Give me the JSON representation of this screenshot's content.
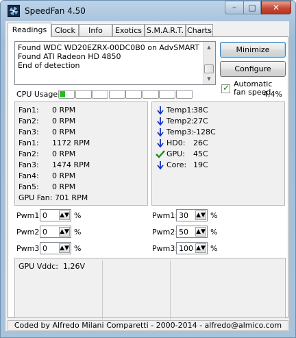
{
  "window": {
    "title": "SpeedFan 4.50",
    "minimize_glyph": "–",
    "maximize_glyph": "□",
    "close_glyph": "✕",
    "app_icon": "fan-icon"
  },
  "tabs": [
    "Readings",
    "Clock",
    "Info",
    "Exotics",
    "S.M.A.R.T.",
    "Charts"
  ],
  "log_lines": [
    "Found WDC WD20EZRX-00DC0B0 on AdvSMART",
    "Found ATI Radeon HD 4850",
    "End of detection"
  ],
  "buttons": {
    "minimize": "Minimize",
    "configure": "Configure"
  },
  "auto_fan": {
    "label": "Automatic fan speed",
    "checked": true
  },
  "cpu_usage": {
    "label": "CPU Usage",
    "value": "4,4%",
    "fraction": 0.044
  },
  "fans": [
    {
      "label": "Fan1:",
      "value": "0 RPM"
    },
    {
      "label": "Fan2:",
      "value": "0 RPM"
    },
    {
      "label": "Fan3:",
      "value": "0 RPM"
    },
    {
      "label": "Fan1:",
      "value": "1172 RPM"
    },
    {
      "label": "Fan2:",
      "value": "0 RPM"
    },
    {
      "label": "Fan3:",
      "value": "1474 RPM"
    },
    {
      "label": "Fan4:",
      "value": "0 RPM"
    },
    {
      "label": "Fan5:",
      "value": "0 RPM"
    }
  ],
  "gpu_fan": "GPU Fan: 701 RPM",
  "temps": [
    {
      "label": "Temp1:",
      "value": "38C",
      "icon": "arrow-down-icon"
    },
    {
      "label": "Temp2:",
      "value": "27C",
      "icon": "arrow-down-icon"
    },
    {
      "label": "Temp3:",
      "value": "-128C",
      "icon": "arrow-down-icon"
    },
    {
      "label": "HD0:",
      "value": "26C",
      "icon": "arrow-down-icon"
    },
    {
      "label": "GPU:",
      "value": "45C",
      "icon": "check-icon"
    },
    {
      "label": "Core:",
      "value": "19C",
      "icon": "arrow-down-icon"
    }
  ],
  "pwm_left": [
    {
      "label": "Pwm1:",
      "value": "0"
    },
    {
      "label": "Pwm2:",
      "value": "0"
    },
    {
      "label": "Pwm3:",
      "value": "0"
    }
  ],
  "pwm_right": [
    {
      "label": "Pwm1:",
      "value": "30"
    },
    {
      "label": "Pwm2:",
      "value": "50"
    },
    {
      "label": "Pwm3:",
      "value": "100"
    }
  ],
  "pwm_unit": "%",
  "voltages": [
    {
      "label": "GPU Vddc:",
      "value": "1,26V"
    }
  ],
  "footer": "Coded by Alfredo Milani Comparetti - 2000-2014 - alfredo@almico.com",
  "colors": {
    "arrow": "#1030c0",
    "check": "#1e8a1e",
    "cpu_fill": "#20c020",
    "close_button": "#c74a35"
  }
}
